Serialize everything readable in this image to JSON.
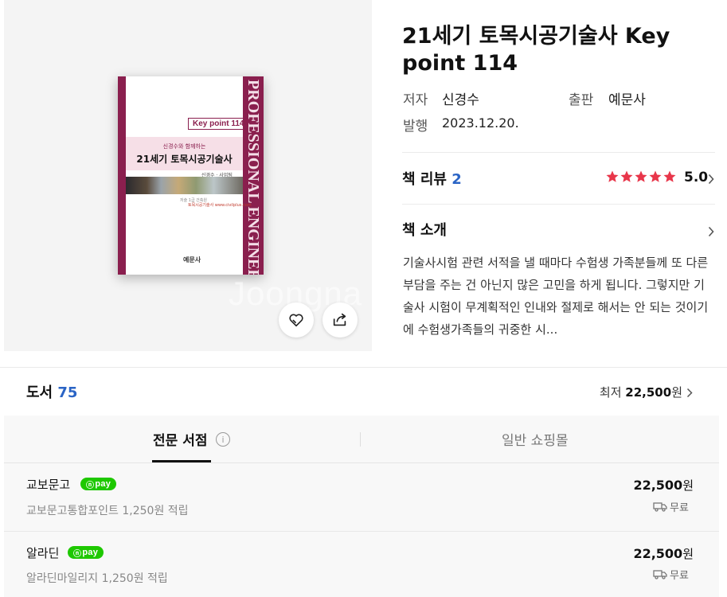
{
  "cover": {
    "watermark": "Joongna",
    "book": {
      "spine_text": "PROFESSIONAL ENGINEER",
      "badge": "Key point 114",
      "subtitle": "신경수와 함께하는",
      "title": "21세기 토목시공기술사",
      "author": "신경수 · 사업팀",
      "small_info": "저술 1급 건축원",
      "pub_line": "토목시공기술사 www.civilplus.com",
      "logo": "예문사"
    },
    "like_icon": "heart-icon",
    "share_icon": "share-icon"
  },
  "product": {
    "title": "21세기 토목시공기술사 Key point 114",
    "author_label": "저자",
    "author": "신경수",
    "publisher_label": "출판",
    "publisher": "예문사",
    "date_label": "발행",
    "date": "2023.12.20."
  },
  "review": {
    "label": "책 리뷰",
    "count": "2",
    "rating": "5.0",
    "stars": 5,
    "star_color": "#e8364a"
  },
  "intro": {
    "label": "책 소개",
    "text": "기술사시험 관련 서적을 낼 때마다 수험생 가족분들께 또 다른 부담을 주는 건 아닌지 많은 고민을 하게 됩니다. 그렇지만 기술사 시험이 무계획적인 인내와 절제로 해서는 안 되는 것이기에 수험생가족들의 귀중한 시..."
  },
  "books": {
    "label": "도서",
    "count": "75",
    "lowest_prefix": "최저",
    "lowest_price": "22,500",
    "currency": "원"
  },
  "tabs": {
    "active": "전문 서점",
    "inactive": "일반 쇼핑몰"
  },
  "stores": [
    {
      "name": "교보문고",
      "npay": "pay",
      "points": "교보문고통합포인트 1,250원 적립",
      "price": "22,500",
      "currency": "원",
      "shipping": "무료"
    },
    {
      "name": "알라딘",
      "npay": "pay",
      "points": "알라딘마일리지 1,250원 적립",
      "price": "22,500",
      "currency": "원",
      "shipping": "무료"
    }
  ],
  "colors": {
    "accent_blue": "#2a64c5",
    "npay_green": "#1ec800",
    "book_maroon": "#8a1f4e"
  }
}
